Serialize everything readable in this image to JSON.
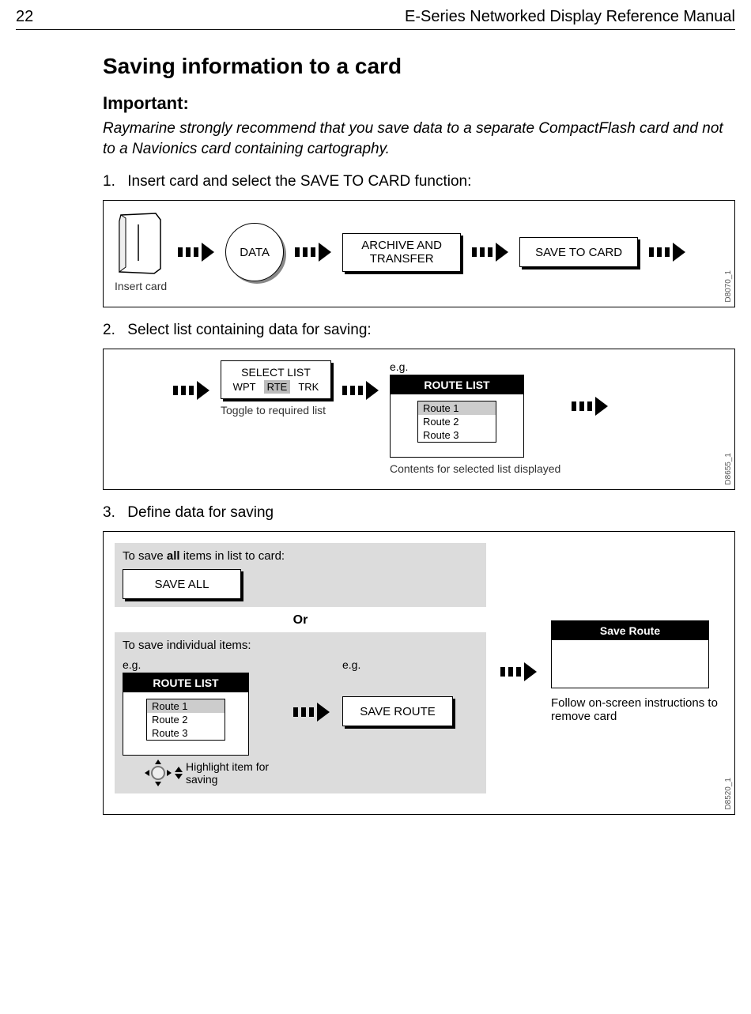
{
  "header": {
    "page_number": "22",
    "manual_title": "E-Series Networked Display Reference Manual"
  },
  "section_title": "Saving information to a card",
  "important": {
    "heading": "Important:",
    "text": "Raymarine strongly recommend that you save data to a separate CompactFlash card and not to a Navionics card containing cartography."
  },
  "steps": {
    "s1": {
      "num": "1.",
      "text": "Insert card and select the SAVE TO CARD function:"
    },
    "s2": {
      "num": "2.",
      "text": "Select list containing data for saving:"
    },
    "s3": {
      "num": "3.",
      "text": "Define data for saving"
    }
  },
  "d1": {
    "insert_card": "Insert card",
    "data": "DATA",
    "archive": "ARCHIVE AND\nTRANSFER",
    "save_to_card": "SAVE TO CARD",
    "code": "D8070_1"
  },
  "d2": {
    "select_list_title": "SELECT LIST",
    "opts": {
      "wpt": "WPT",
      "rte": "RTE",
      "trk": "TRK"
    },
    "toggle_caption": "Toggle to required list",
    "eg": "e.g.",
    "route_list_title": "ROUTE LIST",
    "routes": {
      "r1": "Route 1",
      "r2": "Route 2",
      "r3": "Route 3"
    },
    "contents_caption": "Contents for selected list displayed",
    "code": "D8655_1"
  },
  "d3": {
    "save_all_head_pre": "To save ",
    "save_all_head_bold": "all",
    "save_all_head_post": " items in list to card:",
    "save_all_btn": "SAVE ALL",
    "or": "Or",
    "ind_head": "To save individual items:",
    "eg": "e.g.",
    "route_list_title": "ROUTE LIST",
    "routes": {
      "r1": "Route 1",
      "r2": "Route 2",
      "r3": "Route 3"
    },
    "save_route_btn": "SAVE ROUTE",
    "highlight": "Highlight item for saving",
    "save_route_title": "Save Route",
    "follow": "Follow on-screen instructions to remove card",
    "code": "D8520_1"
  }
}
